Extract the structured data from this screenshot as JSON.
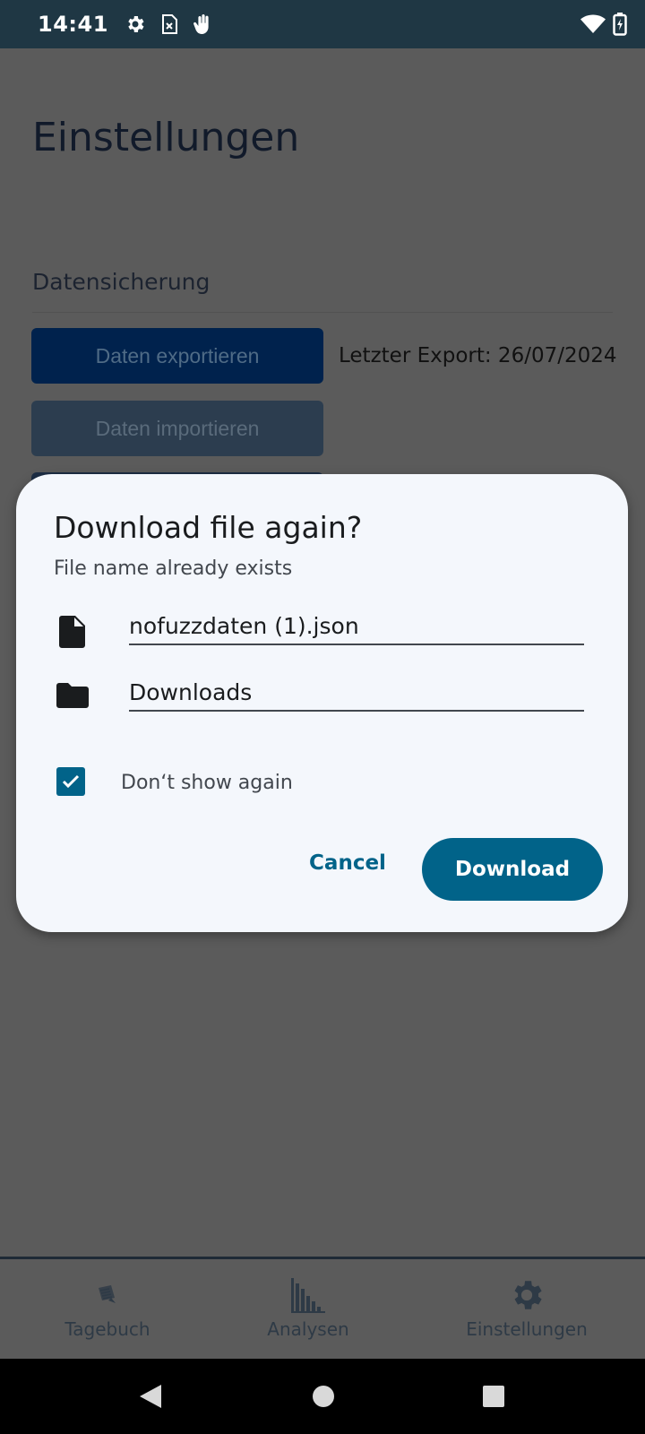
{
  "status_bar": {
    "time": "14:41",
    "left_icons": [
      "gear-icon",
      "sim-card-icon",
      "hand-icon"
    ],
    "right_icons": [
      "wifi-icon",
      "battery-charging-icon"
    ]
  },
  "page": {
    "title": "Einstellungen",
    "section": "Datensicherung",
    "export_button": "Daten exportieren",
    "import_button": "Daten importieren",
    "last_export": "Letzter Export: 26/07/2024"
  },
  "dialog": {
    "title": "Download file again?",
    "subtitle": "File name already exists",
    "file_name": "nofuzzdaten (1).json",
    "folder": "Downloads",
    "checkbox_label": "Don‘t show again",
    "checkbox_checked": true,
    "cancel_label": "Cancel",
    "download_label": "Download",
    "accent_color": "#016389"
  },
  "bottom_nav": {
    "items": [
      {
        "label": "Tagebuch",
        "icon": "notebook-icon"
      },
      {
        "label": "Analysen",
        "icon": "bar-chart-icon"
      },
      {
        "label": "Einstellungen",
        "icon": "gear-icon"
      }
    ]
  },
  "system_nav": [
    "back-icon",
    "home-icon",
    "recents-icon"
  ]
}
